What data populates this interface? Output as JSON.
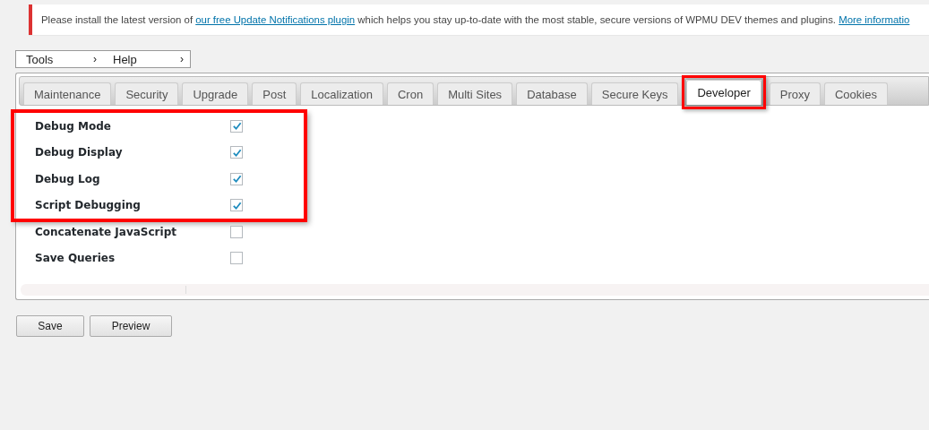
{
  "notice": {
    "text_before": "Please install the latest version of ",
    "link": "our free Update Notifications plugin",
    "text_after": " which helps you stay up-to-date with the most stable, secure versions of WPMU DEV themes and plugins. ",
    "more_link": "More informatio"
  },
  "menu": [
    {
      "label": "Tools",
      "arrow": "›"
    },
    {
      "label": "Help",
      "arrow": "›"
    }
  ],
  "tabs": [
    {
      "label": "Maintenance",
      "selected": false,
      "highlighted": false
    },
    {
      "label": "Security",
      "selected": false,
      "highlighted": false
    },
    {
      "label": "Upgrade",
      "selected": false,
      "highlighted": false
    },
    {
      "label": "Post",
      "selected": false,
      "highlighted": false
    },
    {
      "label": "Localization",
      "selected": false,
      "highlighted": false
    },
    {
      "label": "Cron",
      "selected": false,
      "highlighted": false
    },
    {
      "label": "Multi Sites",
      "selected": false,
      "highlighted": false
    },
    {
      "label": "Database",
      "selected": false,
      "highlighted": false
    },
    {
      "label": "Secure Keys",
      "selected": false,
      "highlighted": false
    },
    {
      "label": "Developer",
      "selected": true,
      "highlighted": true
    },
    {
      "label": "Proxy",
      "selected": false,
      "highlighted": false
    },
    {
      "label": "Cookies",
      "selected": false,
      "highlighted": false
    }
  ],
  "settings": [
    {
      "label": "Debug Mode",
      "checked": true,
      "highlighted": true
    },
    {
      "label": "Debug Display",
      "checked": true,
      "highlighted": true
    },
    {
      "label": "Debug Log",
      "checked": true,
      "highlighted": true
    },
    {
      "label": "Script Debugging",
      "checked": true,
      "highlighted": true
    },
    {
      "label": "Concatenate JavaScript",
      "checked": false,
      "highlighted": false
    },
    {
      "label": "Save Queries",
      "checked": false,
      "highlighted": false
    }
  ],
  "buttons": [
    "Save",
    "Preview"
  ]
}
